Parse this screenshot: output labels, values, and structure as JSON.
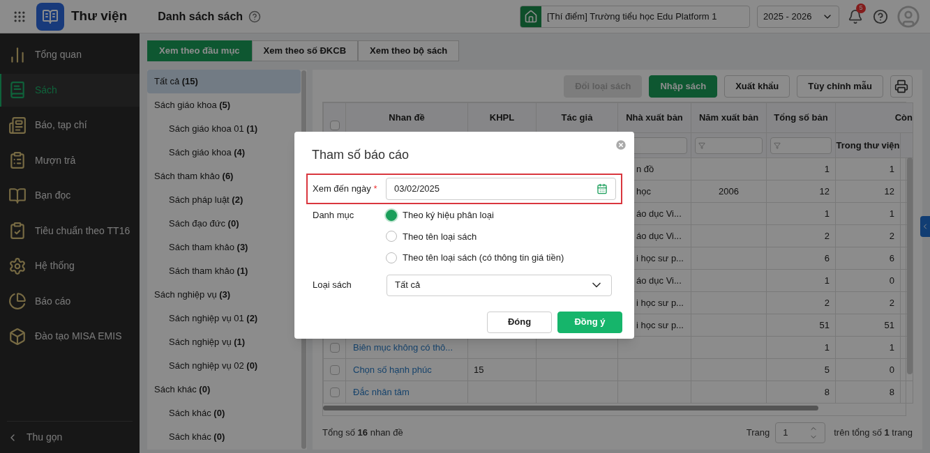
{
  "header": {
    "app_name": "Thư viện",
    "page_title": "Danh sách sách",
    "school": "[Thí điểm] Trường tiểu học Edu Platform 1",
    "year": "2025 - 2026",
    "notifications": "5"
  },
  "sidebar": {
    "items": [
      {
        "label": "Tổng quan",
        "selected": false
      },
      {
        "label": "Sách",
        "selected": true
      },
      {
        "label": "Báo, tạp chí",
        "selected": false
      },
      {
        "label": "Mượn trả",
        "selected": false
      },
      {
        "label": "Bạn đọc",
        "selected": false
      },
      {
        "label": "Tiêu chuẩn theo TT16",
        "selected": false
      },
      {
        "label": "Hệ thống",
        "selected": false
      },
      {
        "label": "Báo cáo",
        "selected": false
      },
      {
        "label": "Đào tạo MISA EMIS",
        "selected": false
      }
    ],
    "collapse": "Thu gọn"
  },
  "tabs": [
    {
      "label": "Xem theo đầu mục",
      "selected": true
    },
    {
      "label": "Xem theo số ĐKCB",
      "selected": false
    },
    {
      "label": "Xem theo bộ sách",
      "selected": false
    }
  ],
  "tree": [
    {
      "label": "Tất cả **(15)**",
      "selected": true
    },
    {
      "label": "Sách giáo khoa **(5)**",
      "selected": false,
      "children": [
        {
          "label": "Sách giáo khoa 01 **(1)**",
          "selected": false
        },
        {
          "label": "Sách giáo khoa **(4)**",
          "selected": false
        }
      ]
    },
    {
      "label": "Sách tham khảo **(6)**",
      "selected": false,
      "children": [
        {
          "label": "Sách pháp luật **(2)**",
          "selected": false
        },
        {
          "label": "Sách đạo đức **(0)**",
          "selected": false
        },
        {
          "label": "Sách tham khảo **(3)**",
          "selected": false
        },
        {
          "label": "Sách tham khảo **(1)**",
          "selected": false
        }
      ]
    },
    {
      "label": "Sách nghiệp vụ **(3)**",
      "selected": false,
      "children": [
        {
          "label": "Sách nghiệp vụ 01 **(2)**",
          "selected": false
        },
        {
          "label": "Sách nghiệp vụ **(1)**",
          "selected": false
        },
        {
          "label": "Sách nghiệp vụ 02 **(0)**",
          "selected": false
        }
      ]
    },
    {
      "label": "Sách khác **(0)**",
      "selected": false,
      "children": [
        {
          "label": "Sách khác **(0)**",
          "selected": false
        },
        {
          "label": "Sách khác **(0)**",
          "selected": false
        }
      ]
    }
  ],
  "toolbar": [
    {
      "label": "Đổi loại sách",
      "kind": "secondary",
      "disabled": true
    },
    {
      "label": "Nhập sách",
      "kind": "primary",
      "disabled": false
    },
    {
      "label": "Xuất khẩu",
      "kind": "secondary",
      "disabled": false
    },
    {
      "label": "Tùy chỉnh mẫu",
      "kind": "secondary",
      "disabled": false
    }
  ],
  "table": {
    "columns": [
      "Nhan đề",
      "KHPL",
      "Tác giả",
      "Nhà xuất bản",
      "Năm xuất bản",
      "Tổng số bản"
    ],
    "group_header": "Còn",
    "all_checked": false,
    "sub_column": "Trong thư viện",
    "rows": [
      {
        "publisher": "n đồ",
        "total": "1",
        "in_library": "1"
      },
      {
        "publisher": "học",
        "year": "2006",
        "total": "12",
        "in_library": "12"
      },
      {
        "publisher": "áo dục Vi...",
        "total": "1",
        "in_library": "1"
      },
      {
        "publisher": "áo dục Vi...",
        "total": "2",
        "in_library": "2"
      },
      {
        "publisher": "i học sư p...",
        "total": "6",
        "in_library": "6"
      },
      {
        "publisher": "áo dục Vi...",
        "total": "1",
        "in_library": "0"
      },
      {
        "publisher": "i học sư p...",
        "total": "2",
        "in_library": "2"
      },
      {
        "publisher": "i học sư p...",
        "total": "51",
        "in_library": "51"
      },
      {
        "title": "Biên mục không có thô...",
        "checked": false,
        "total": "1",
        "in_library": "1"
      },
      {
        "title": "Chọn số hạnh phúc",
        "checked": false,
        "khpl": "15",
        "total": "5",
        "in_library": "0"
      },
      {
        "title": "Đắc nhân tâm",
        "checked": false,
        "total": "8",
        "in_library": "8"
      }
    ]
  },
  "footer": {
    "summary": "Tổng số **16** nhan đề",
    "page_label": "Trang",
    "page": "1",
    "total_pages": "trên tổng số **1** trang"
  },
  "dialog": {
    "title": "Tham số báo cáo",
    "date_label": "Xem đến ngày",
    "required_mark": "*",
    "date_value": "03/02/2025",
    "category_label": "Danh mục",
    "options": [
      {
        "label": "Theo ký hiệu phân loại",
        "selected": true
      },
      {
        "label": "Theo tên loại sách",
        "selected": false
      },
      {
        "label": "Theo tên loại sách (có thông tin giá tiền)",
        "selected": false
      }
    ],
    "type_label": "Loại sách",
    "type_value": "Tất cả",
    "buttons": [
      {
        "label": "Đóng",
        "kind": "secondary"
      },
      {
        "label": "Đồng ý",
        "kind": "primary"
      }
    ]
  }
}
